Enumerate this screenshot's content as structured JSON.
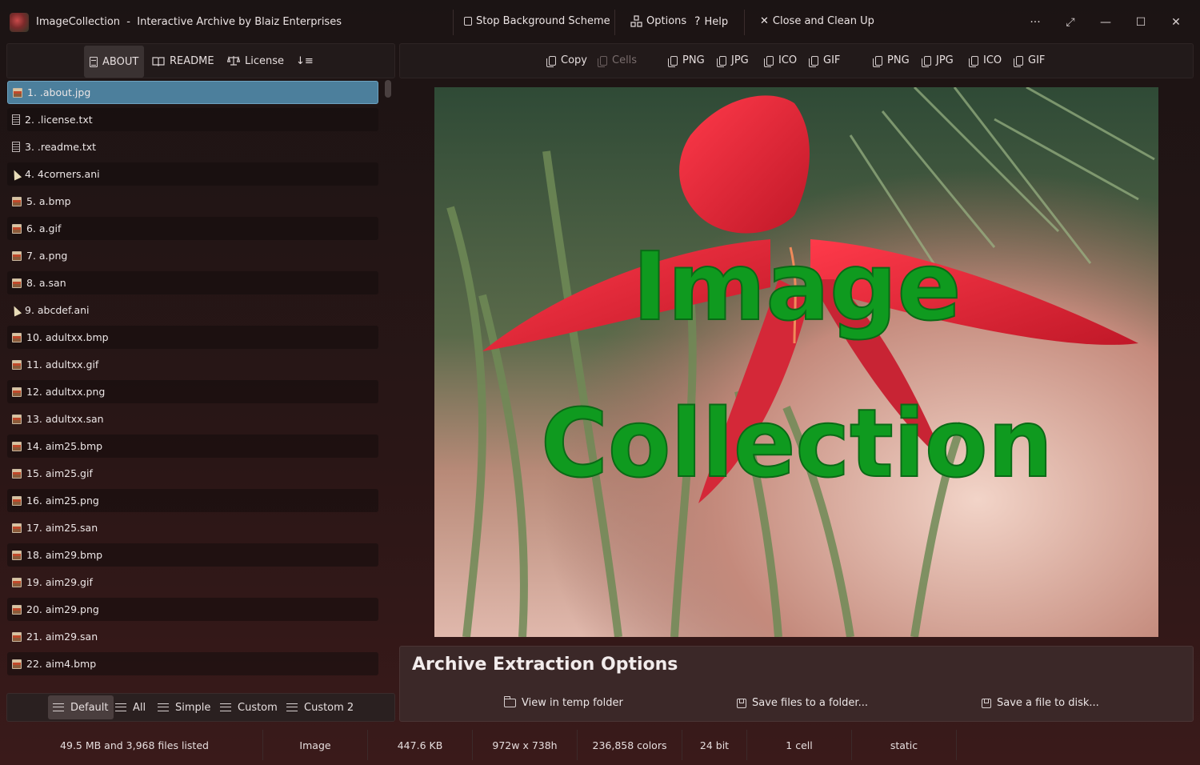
{
  "window": {
    "app_name": "ImageCollection",
    "title_separator": "-",
    "subtitle": "Interactive Archive by Blaiz Enterprises",
    "stop_background": "Stop Background Scheme",
    "options": "Options",
    "help": "Help",
    "close_clean": "Close and Clean Up",
    "more": "···",
    "expand": "⤢",
    "minimize": "—",
    "maximize": "☐",
    "close": "✕"
  },
  "left_tabs": {
    "about": "ABOUT",
    "readme": "README",
    "license": "License",
    "sort": "↓≡"
  },
  "right_toolbar": {
    "copy": "Copy",
    "cells": "Cells",
    "group1": [
      "PNG",
      "JPG",
      "ICO",
      "GIF"
    ],
    "group2": [
      "PNG",
      "JPG",
      "ICO",
      "GIF"
    ]
  },
  "files": [
    {
      "label": "1. .about.jpg",
      "icon": "image"
    },
    {
      "label": "2. .license.txt",
      "icon": "text"
    },
    {
      "label": "3. .readme.txt",
      "icon": "text"
    },
    {
      "label": "4. 4corners.ani",
      "icon": "cursor"
    },
    {
      "label": "5. a.bmp",
      "icon": "image"
    },
    {
      "label": "6. a.gif",
      "icon": "image"
    },
    {
      "label": "7. a.png",
      "icon": "image"
    },
    {
      "label": "8. a.san",
      "icon": "image"
    },
    {
      "label": "9. abcdef.ani",
      "icon": "cursor"
    },
    {
      "label": "10. adultxx.bmp",
      "icon": "image"
    },
    {
      "label": "11. adultxx.gif",
      "icon": "image"
    },
    {
      "label": "12. adultxx.png",
      "icon": "image"
    },
    {
      "label": "13. adultxx.san",
      "icon": "image"
    },
    {
      "label": "14. aim25.bmp",
      "icon": "image"
    },
    {
      "label": "15. aim25.gif",
      "icon": "image"
    },
    {
      "label": "16. aim25.png",
      "icon": "image"
    },
    {
      "label": "17. aim25.san",
      "icon": "image"
    },
    {
      "label": "18. aim29.bmp",
      "icon": "image"
    },
    {
      "label": "19. aim29.gif",
      "icon": "image"
    },
    {
      "label": "20. aim29.png",
      "icon": "image"
    },
    {
      "label": "21. aim29.san",
      "icon": "image"
    },
    {
      "label": "22. aim4.bmp",
      "icon": "image"
    }
  ],
  "selected_index": 0,
  "view_tabs": [
    "Default",
    "All",
    "Simple",
    "Custom",
    "Custom 2"
  ],
  "preview": {
    "line1": "Image",
    "line2": "Collection"
  },
  "extraction": {
    "title": "Archive Extraction Options",
    "view_temp": "View in temp folder",
    "save_folder": "Save files to a folder...",
    "save_disk": "Save a file to disk..."
  },
  "status": {
    "summary": "49.5 MB and 3,968 files listed",
    "type": "Image",
    "size": "447.6 KB",
    "dimensions": "972w x 738h",
    "colors": "236,858 colors",
    "depth": "24 bit",
    "cells": "1 cell",
    "mode": "static"
  },
  "colors": {
    "selection": "#4c7f9c",
    "logo_green": "#0f9a1f"
  }
}
